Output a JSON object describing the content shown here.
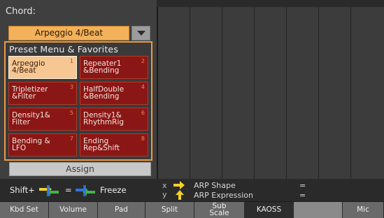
{
  "chord": {
    "label": "Chord:",
    "selected": "Arpeggio 4/Beat"
  },
  "favorites": {
    "title": "Preset Menu & Favorites",
    "items": [
      {
        "label": "Arpeggio\n4/Beat",
        "num": "1",
        "selected": true
      },
      {
        "label": "Repeater1\n&Bending",
        "num": "2",
        "selected": false
      },
      {
        "label": "Tripletizer\n&Filter",
        "num": "3",
        "selected": false
      },
      {
        "label": "HalfDouble\n&Bending",
        "num": "4",
        "selected": false
      },
      {
        "label": "Density1&\nFilter",
        "num": "5",
        "selected": false
      },
      {
        "label": "Density1&\nRhythmRig",
        "num": "6",
        "selected": false
      },
      {
        "label": "Bending &\nLFO",
        "num": "7",
        "selected": false
      },
      {
        "label": "Ending\nRep&Shift",
        "num": "8",
        "selected": false
      }
    ],
    "assign": "Assign"
  },
  "shift": {
    "prefix": "Shift+",
    "equals": "=",
    "freeze": "Freeze"
  },
  "xy": {
    "x_axis": "x",
    "y_axis": "y",
    "x_param": "ARP Shape",
    "y_param": "ARP Expression",
    "x_value": "=",
    "y_value": "="
  },
  "tabs": [
    {
      "label": "Kbd Set"
    },
    {
      "label": "Volume"
    },
    {
      "label": "Pad"
    },
    {
      "label": "Split"
    },
    {
      "label": "Sub\nScale"
    },
    {
      "label": "KAOSS",
      "active": true
    },
    {
      "label": ""
    },
    {
      "label": "Mic"
    }
  ],
  "colors": {
    "accent": "#f3b15a",
    "pad_button": "#8a1616",
    "selected_pad": "#f6c793",
    "arrow_yellow": "#f2d22a",
    "arrow_blue": "#2f74e0",
    "arrow_green": "#44b44c"
  },
  "icons": {
    "dropdown": "chevron-down-icon",
    "x_arrow": "arrow-right-icon",
    "y_arrow": "arrow-up-icon",
    "shift_arrows": "xy-arrows-icon",
    "freeze_arrows": "freeze-arrows-icon"
  }
}
